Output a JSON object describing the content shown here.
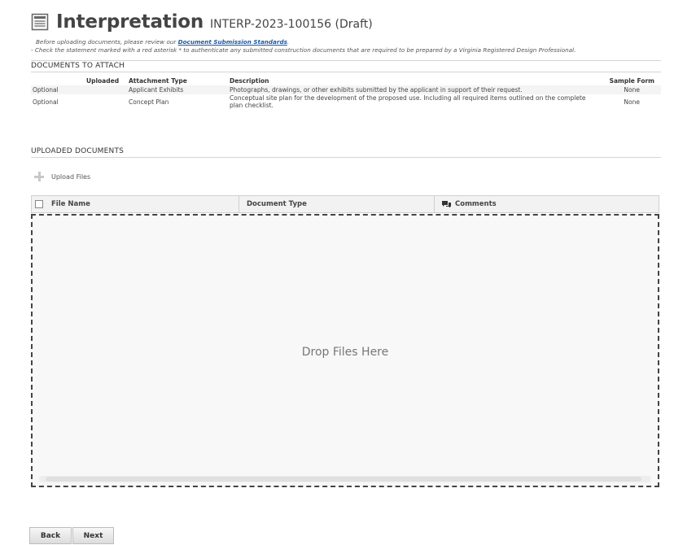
{
  "header": {
    "title": "Interpretation",
    "record_id": "INTERP-2023-100156 (Draft)"
  },
  "instructions": {
    "line1_prefix": "Before uploading documents, please review our ",
    "line1_link": "Document Submission Standards",
    "line1_suffix": ".",
    "line2": "- Check the statement marked with a red asterisk * to authenticate any submitted construction documents that are required to be prepared by a Virginia Registered Design Professional."
  },
  "documents_to_attach": {
    "section_title": "DOCUMENTS TO ATTACH",
    "columns": [
      "",
      "Uploaded",
      "Attachment Type",
      "Description",
      "Sample Form"
    ],
    "rows": [
      {
        "requirement": "Optional",
        "uploaded": "",
        "attachment_type": "Applicant Exhibits",
        "description": "Photographs, drawings, or other exhibits submitted by the applicant in support of their request.",
        "sample_form": "None"
      },
      {
        "requirement": "Optional",
        "uploaded": "",
        "attachment_type": "Concept Plan",
        "description": "Conceptual site plan for the development of the proposed use. Including all required items outlined on the complete plan checklist.",
        "sample_form": "None"
      }
    ]
  },
  "uploaded_documents": {
    "section_title": "UPLOADED DOCUMENTS",
    "upload_label": "Upload Files",
    "columns": {
      "file_name": "File Name",
      "document_type": "Document Type",
      "comments": "Comments"
    },
    "drop_text": "Drop Files Here"
  },
  "footer": {
    "back_label": "Back",
    "next_label": "Next"
  },
  "icons": {
    "header_icon": "document-icon",
    "upload_icon": "plus-icon",
    "comments_icon": "speech-bubbles-icon"
  },
  "colors": {
    "link": "#1a5aa6",
    "drop_border": "#444444"
  }
}
